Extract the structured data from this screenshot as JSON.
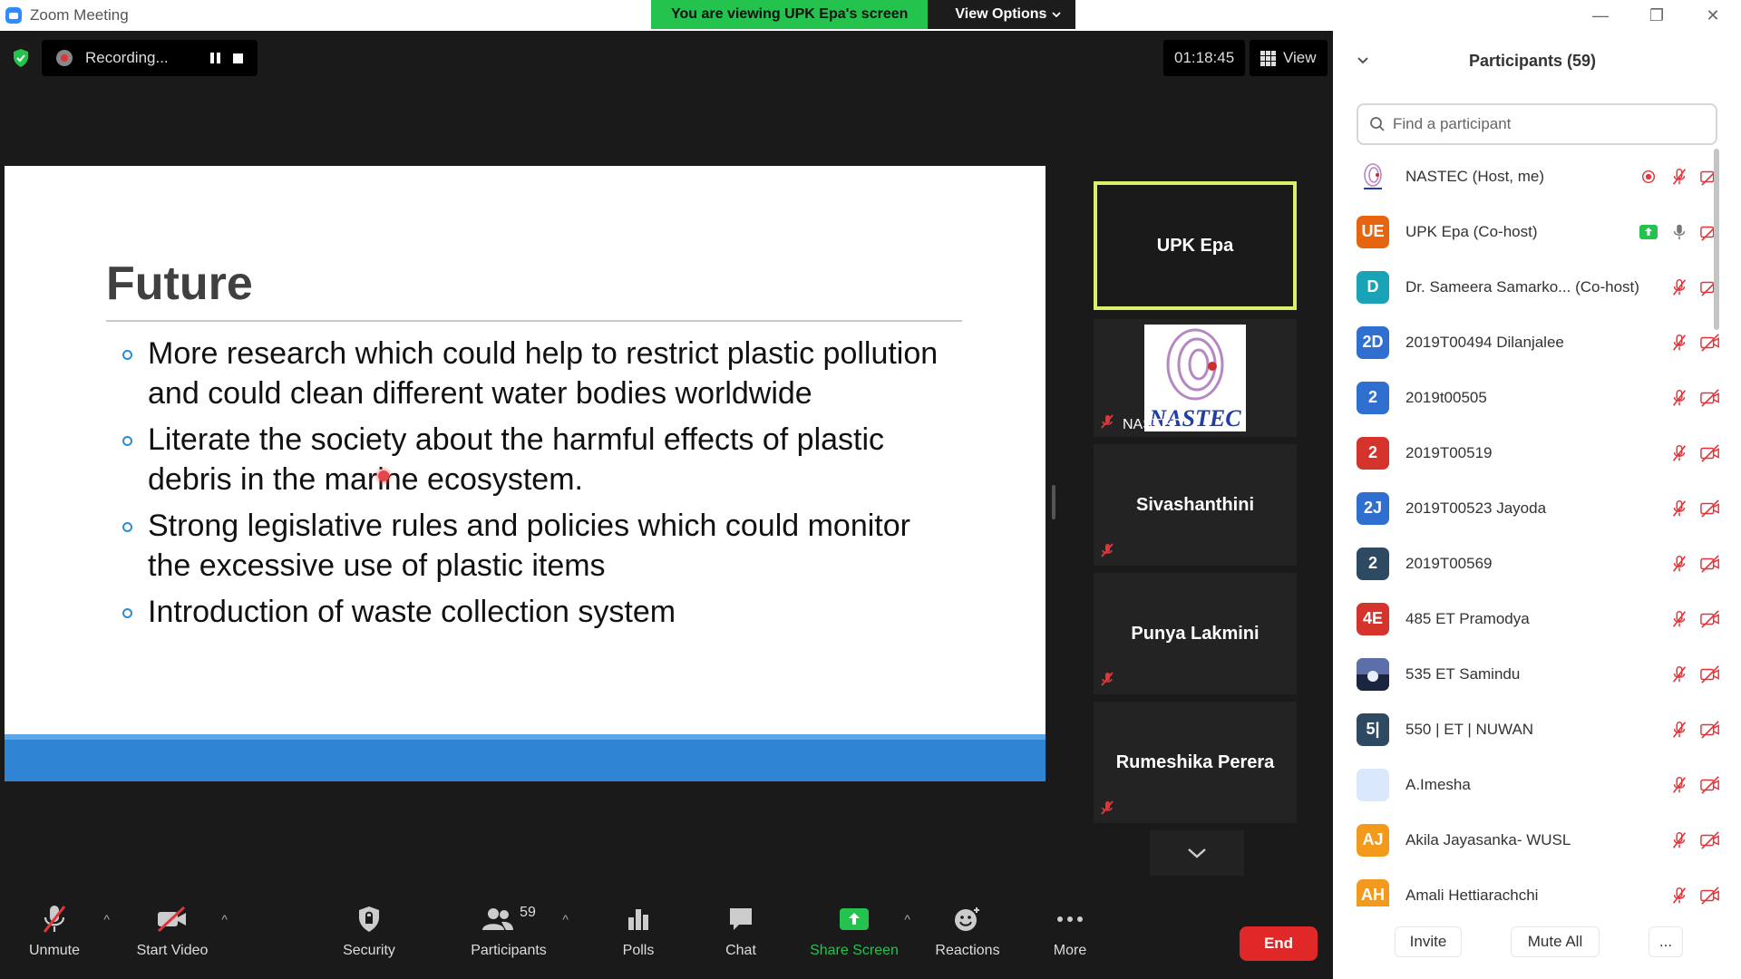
{
  "window": {
    "title": "Zoom Meeting",
    "banner_text": "You are viewing UPK Epa's screen",
    "view_options_label": "View Options"
  },
  "top": {
    "recording_label": "Recording...",
    "timer": "01:18:45",
    "view_label": "View"
  },
  "slide": {
    "title": "Future",
    "bullets": [
      "More research which could help to restrict plastic pollution and could clean different water bodies worldwide",
      "Literate the society about the harmful effects of plastic debris in the marine ecosystem.",
      "Strong legislative rules and policies which could monitor the excessive use of plastic items",
      "Introduction of waste collection system"
    ]
  },
  "gallery": {
    "tiles": [
      {
        "name": "UPK Epa"
      },
      {
        "name": "NASTEC",
        "logo_text": "NASTEC"
      },
      {
        "name": "Sivashanthini"
      },
      {
        "name": "Punya Lakmini"
      },
      {
        "name": "Rumeshika Perera"
      }
    ]
  },
  "toolbar": {
    "unmute": "Unmute",
    "start_video": "Start Video",
    "security": "Security",
    "participants": "Participants",
    "participants_count": "59",
    "polls": "Polls",
    "chat": "Chat",
    "share_screen": "Share Screen",
    "reactions": "Reactions",
    "more": "More",
    "end": "End"
  },
  "panel": {
    "title": "Participants (59)",
    "search_placeholder": "Find a participant",
    "participants": [
      {
        "initials": "",
        "name": "NASTEC (Host, me)",
        "color": "#ffffff",
        "logo": true,
        "recording": true
      },
      {
        "initials": "UE",
        "name": "UPK Epa (Co-host)",
        "color": "#E8650F",
        "sharing": true,
        "mic_on": true
      },
      {
        "initials": "D",
        "name": "Dr. Sameera Samarko... (Co-host)",
        "color": "#1AA3B6"
      },
      {
        "initials": "2D",
        "name": "2019T00494 Dilanjalee",
        "color": "#2F6FD0"
      },
      {
        "initials": "2",
        "name": "2019t00505",
        "color": "#2F6FD0"
      },
      {
        "initials": "2",
        "name": "2019T00519",
        "color": "#D4342C"
      },
      {
        "initials": "2J",
        "name": "2019T00523 Jayoda",
        "color": "#2F6FD0"
      },
      {
        "initials": "2",
        "name": "2019T00569",
        "color": "#2E4A63"
      },
      {
        "initials": "4E",
        "name": "485 ET Pramodya",
        "color": "#D4342C"
      },
      {
        "initials": "",
        "name": "535 ET Samindu",
        "color": "#3a4a78",
        "photo": true
      },
      {
        "initials": "5|",
        "name": "550 | ET | NUWAN",
        "color": "#2E4A63"
      },
      {
        "initials": "",
        "name": "A.Imesha",
        "color": "#D9E9FB"
      },
      {
        "initials": "AJ",
        "name": "Akila Jayasanka- WUSL",
        "color": "#F39A1C"
      },
      {
        "initials": "AH",
        "name": "Amali Hettiarachchi",
        "color": "#F39A1C"
      }
    ],
    "invite": "Invite",
    "mute_all": "Mute All",
    "more": "..."
  }
}
